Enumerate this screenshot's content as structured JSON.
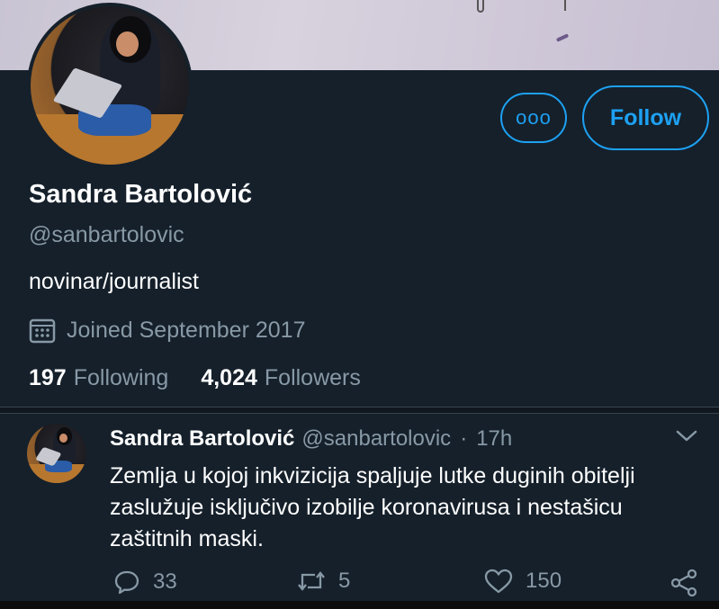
{
  "profile": {
    "display_name": "Sandra Bartolović",
    "handle": "@sanbartolovic",
    "bio": "novinar/journalist",
    "joined": "Joined September 2017",
    "following_count": "197",
    "following_label": "Following",
    "followers_count": "4,024",
    "followers_label": "Followers"
  },
  "buttons": {
    "more_label": "ooo",
    "follow_label": "Follow"
  },
  "tweet": {
    "name": "Sandra Bartolović",
    "handle": "@sanbartolovic",
    "separator": "·",
    "time": "17h",
    "text": "Zemlja u kojoj inkvizicija spaljuje lutke duginih obitelji zaslužuje isključivo izobilje koronavirusa i nestašicu zaštitnih maski.",
    "reply_count": "33",
    "retweet_count": "5",
    "like_count": "150"
  },
  "icons": {
    "calendar": "calendar-icon",
    "reply": "reply-icon",
    "retweet": "retweet-icon",
    "like": "heart-icon",
    "share": "share-icon",
    "caret": "chevron-down-icon"
  },
  "colors": {
    "background": "#15202b",
    "accent": "#1da1f2",
    "secondary_text": "#8899a6",
    "primary_text": "#ffffff"
  }
}
